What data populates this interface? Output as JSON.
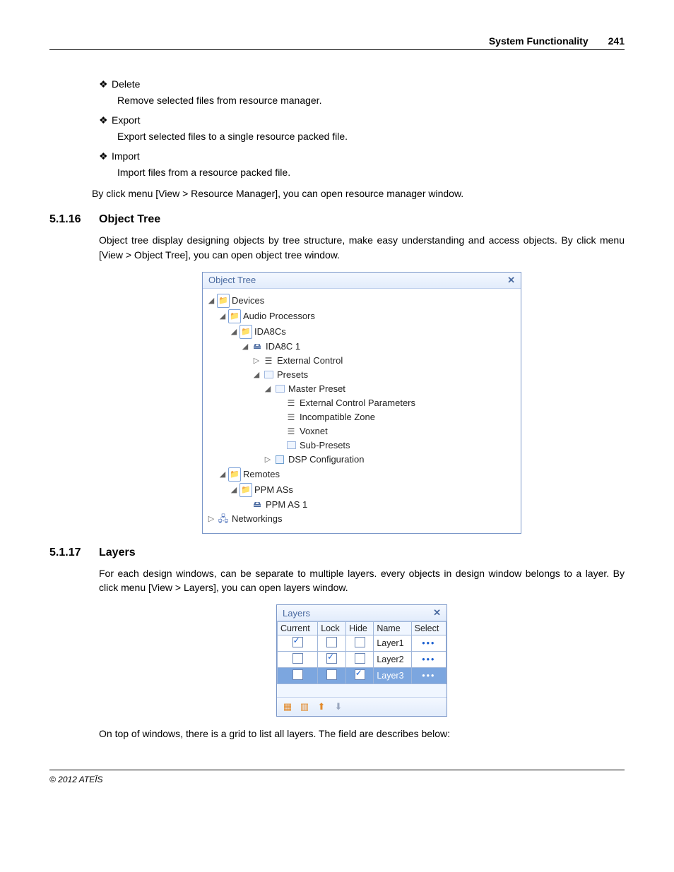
{
  "header": {
    "title": "System Functionality",
    "page": "241"
  },
  "bullets": [
    {
      "title": "Delete",
      "desc": "Remove selected files from resource manager."
    },
    {
      "title": "Export",
      "desc": "Export selected files to a single resource packed file."
    },
    {
      "title": "Import",
      "desc": "Import files from a resource packed file."
    }
  ],
  "para_after_bullets": "By click menu [View > Resource Manager], you can open resource manager window.",
  "sec1": {
    "num": "5.1.16",
    "title": "Object Tree"
  },
  "sec1_para": "Object tree display designing objects by tree structure, make easy understanding and access objects. By click menu [View > Object Tree], you can open object tree window.",
  "object_tree": {
    "title": "Object Tree",
    "nodes": [
      {
        "depth": 0,
        "twist": "◢",
        "icon": "folder",
        "label": "Devices"
      },
      {
        "depth": 1,
        "twist": "◢",
        "icon": "folder",
        "label": "Audio Processors"
      },
      {
        "depth": 2,
        "twist": "◢",
        "icon": "folder",
        "label": "IDA8Cs"
      },
      {
        "depth": 3,
        "twist": "◢",
        "icon": "dev",
        "label": "IDA8C 1"
      },
      {
        "depth": 4,
        "twist": "▷",
        "icon": "stack",
        "label": "External Control"
      },
      {
        "depth": 4,
        "twist": "◢",
        "icon": "img",
        "label": "Presets"
      },
      {
        "depth": 5,
        "twist": "◢",
        "icon": "img",
        "label": "Master Preset"
      },
      {
        "depth": 6,
        "twist": "",
        "icon": "stack",
        "label": "External Control Parameters"
      },
      {
        "depth": 6,
        "twist": "",
        "icon": "stack",
        "label": "Incompatible Zone"
      },
      {
        "depth": 6,
        "twist": "",
        "icon": "stack",
        "label": "Voxnet"
      },
      {
        "depth": 6,
        "twist": "",
        "icon": "img",
        "label": "Sub-Presets"
      },
      {
        "depth": 5,
        "twist": "▷",
        "icon": "box",
        "label": "DSP Configuration"
      },
      {
        "depth": 1,
        "twist": "◢",
        "icon": "folder",
        "label": "Remotes"
      },
      {
        "depth": 2,
        "twist": "◢",
        "icon": "folder",
        "label": "PPM ASs"
      },
      {
        "depth": 3,
        "twist": "",
        "icon": "dev",
        "label": "PPM AS 1"
      },
      {
        "depth": 0,
        "twist": "▷",
        "icon": "net",
        "label": "Networkings"
      }
    ]
  },
  "sec2": {
    "num": "5.1.17",
    "title": "Layers"
  },
  "sec2_para": "For each design windows, can be separate to multiple layers. every objects in design window belongs to a layer. By click menu [View > Layers], you can open layers window.",
  "layers": {
    "title": "Layers",
    "headers": [
      "Current",
      "Lock",
      "Hide",
      "Name",
      "Select"
    ],
    "rows": [
      {
        "current": true,
        "lock": false,
        "hide": false,
        "name": "Layer1",
        "selected": false
      },
      {
        "current": false,
        "lock": true,
        "hide": false,
        "name": "Layer2",
        "selected": false
      },
      {
        "current": false,
        "lock": false,
        "hide": true,
        "name": "Layer3",
        "selected": true
      }
    ]
  },
  "sec2_after": "On top of windows, there is a grid to list all layers. The field are describes below:",
  "footer": "© 2012 ATEÏS"
}
